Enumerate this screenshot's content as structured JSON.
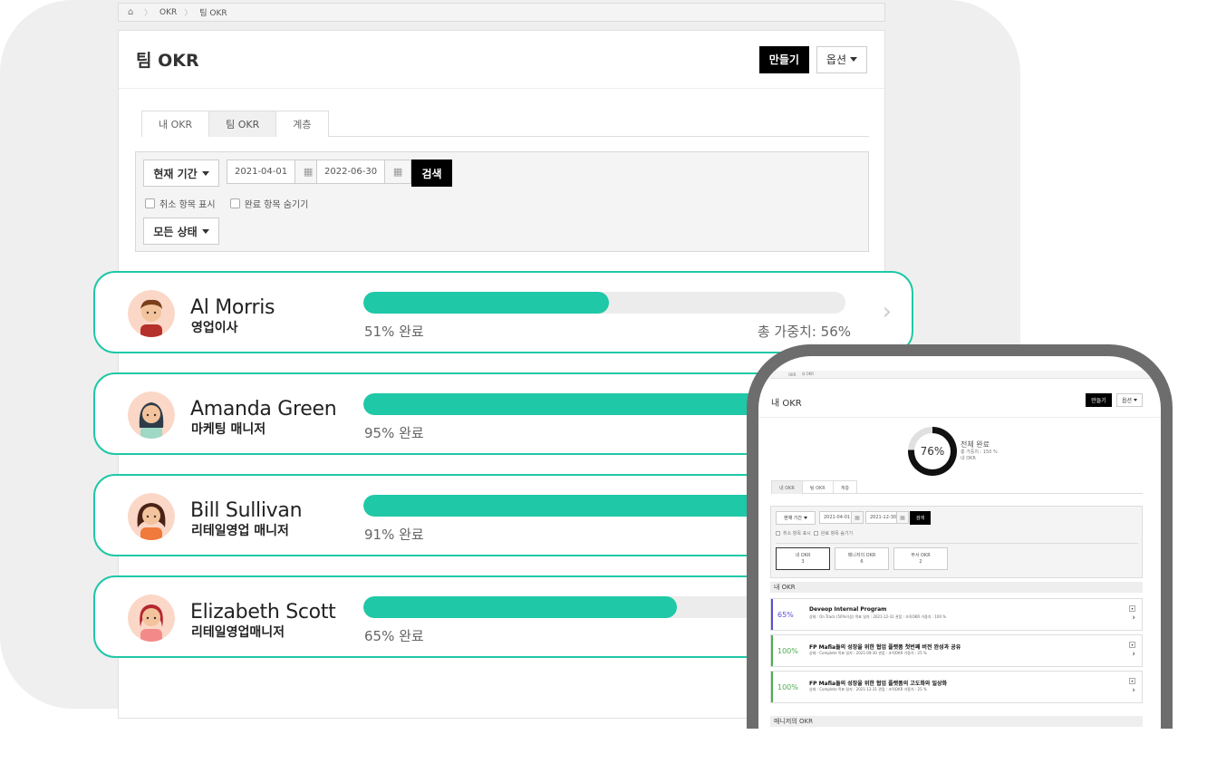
{
  "breadcrumb": {
    "items": [
      "OKR",
      "팀 OKR"
    ]
  },
  "page": {
    "title": "팀 OKR",
    "create_label": "만들기",
    "options_label": "옵션"
  },
  "tabs": [
    {
      "label": "내 OKR"
    },
    {
      "label": "팀 OKR"
    },
    {
      "label": "계층"
    }
  ],
  "filter": {
    "period_label": "현재 기간",
    "start_date": "2021-04-01",
    "end_date": "2022-06-30",
    "search_label": "검색",
    "show_cancelled_label": "취소 항목 표시",
    "hide_completed_label": "완료 항목 숨기기",
    "status_label": "모든 상태"
  },
  "people": [
    {
      "name": "Al Morris",
      "role": "영업이사",
      "progress": 51,
      "progress_label": "51% 완료",
      "weight_label": "총 가중치: 56%"
    },
    {
      "name": "Amanda Green",
      "role": "마케팅 매니저",
      "progress": 95,
      "progress_label": "95% 완료"
    },
    {
      "name": "Bill Sullivan",
      "role": "리테일영업 매니저",
      "progress": 91,
      "progress_label": "91% 완료"
    },
    {
      "name": "Elizabeth Scott",
      "role": "리테일영업매니저",
      "progress": 65,
      "progress_label": "65% 완료"
    }
  ],
  "colors": {
    "accent": "#1fc8a6",
    "track": "#ececec",
    "dark_button": "#000000"
  },
  "mobile": {
    "breadcrumb": [
      "OKR",
      "내 OKR"
    ],
    "title": "내 OKR",
    "create_label": "만들기",
    "options_label": "옵션",
    "overall_pct": 76,
    "overall_pct_label": "76%",
    "overall_label": "전체 완료",
    "overall_sub1": "총 가중치 : 150 %",
    "overall_sub2": "내 OKR",
    "tabs": [
      "내 OKR",
      "팀 OKR",
      "계층"
    ],
    "period_label": "현재 기간",
    "start_date": "2021-04-01",
    "end_date": "2021-12-30",
    "search_label": "검색",
    "show_cancelled_label": "취소 항목 표시",
    "hide_completed_label": "완료 항목 숨기기",
    "counts": [
      {
        "label": "내 OKR",
        "value": "3"
      },
      {
        "label": "매니저의 OKR",
        "value": "6"
      },
      {
        "label": "부서 OKR",
        "value": "2"
      }
    ],
    "section_my": "내 OKR",
    "section_manager": "매니저의 OKR",
    "items": [
      {
        "pct": "65%",
        "title": "Deveop Internal Program",
        "meta": "상태 : On Track (50%이상)   목표 일자 : 2021-12-31   관점 : 조직OKR   가중치 : 100 %",
        "color": "#5a4fd6"
      },
      {
        "pct": "100%",
        "title": "FP Mafia들의 성장을 위한 협업 플랫폼 첫번째 버전 완성과 공유",
        "meta": "상태 : Complete   목표 일자 : 2021-09-30   관점 : 조직OKR   가중치 : 25 %",
        "color": "#4caf50"
      },
      {
        "pct": "100%",
        "title": "FP Mafia들의 성장을 위한 협업 플랫폼의 고도화와 일상화",
        "meta": "상태 : Complete   목표 일자 : 2021-12-31   관점 : 조직OKR   가중치 : 25 %",
        "color": "#4caf50"
      }
    ]
  }
}
